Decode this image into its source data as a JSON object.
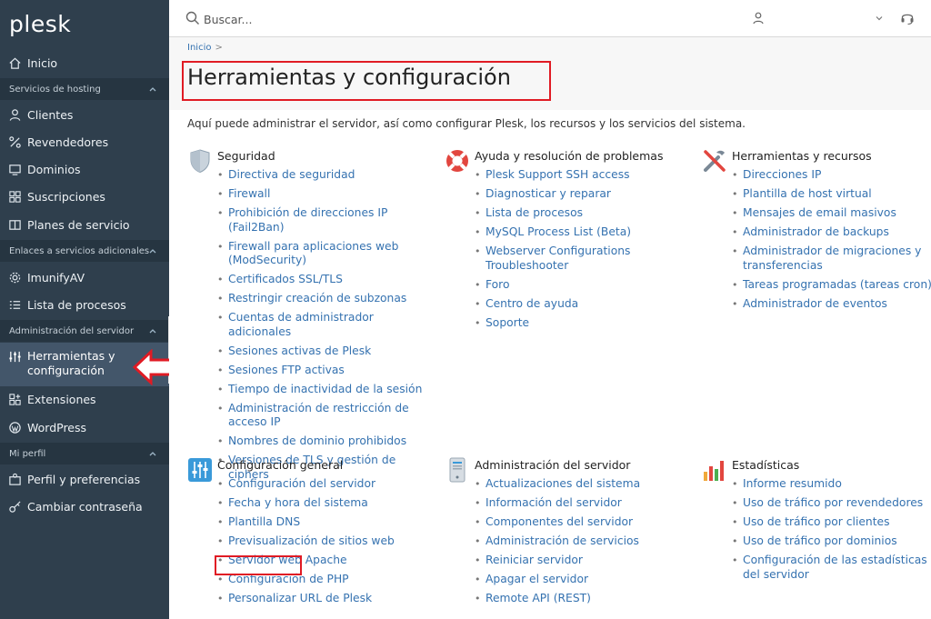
{
  "app": {
    "logo": "plesk"
  },
  "search": {
    "placeholder": "Buscar..."
  },
  "sidebar": {
    "home": "Inicio",
    "sections": [
      {
        "label": "Servicios de hosting"
      },
      {
        "label": "Enlaces a servicios adicionales"
      },
      {
        "label": "Administración del servidor"
      },
      {
        "label": "Mi perfil"
      }
    ],
    "items": [
      {
        "label": "Clientes"
      },
      {
        "label": "Revendedores"
      },
      {
        "label": "Dominios"
      },
      {
        "label": "Suscripciones"
      },
      {
        "label": "Planes de servicio"
      },
      {
        "label": "ImunifyAV"
      },
      {
        "label": "Lista de procesos"
      },
      {
        "label": "Herramientas y configuración"
      },
      {
        "label": "Extensiones"
      },
      {
        "label": "WordPress"
      },
      {
        "label": "Perfil y preferencias"
      },
      {
        "label": "Cambiar contraseña"
      }
    ]
  },
  "breadcrumb": {
    "home": "Inicio",
    "sep": ">"
  },
  "page": {
    "title": "Herramientas y configuración",
    "intro": "Aquí puede administrar el servidor, así como configurar Plesk, los recursos y los servicios del sistema."
  },
  "groups": [
    {
      "title": "Seguridad",
      "icon": "shield-icon",
      "links": [
        "Directiva de seguridad",
        "Firewall",
        "Prohibición de direcciones IP (Fail2Ban)",
        "Firewall para aplicaciones web (ModSecurity)",
        "Certificados SSL/TLS",
        "Restringir creación de subzonas",
        "Cuentas de administrador adicionales",
        "Sesiones activas de Plesk",
        "Sesiones FTP activas",
        "Tiempo de inactividad de la sesión",
        "Administración de restricción de acceso IP",
        "Nombres de dominio prohibidos",
        "Versiones de TLS y gestión de ciphers"
      ]
    },
    {
      "title": "Ayuda y resolución de problemas",
      "icon": "lifebuoy-icon",
      "links": [
        "Plesk Support SSH access",
        "Diagnosticar y reparar",
        "Lista de procesos",
        "MySQL Process List (Beta)",
        "Webserver Configurations Troubleshooter",
        "Foro",
        "Centro de ayuda",
        "Soporte"
      ]
    },
    {
      "title": "Herramientas y recursos",
      "icon": "tools-icon",
      "links": [
        "Direcciones IP",
        "Plantilla de host virtual",
        "Mensajes de email masivos",
        "Administrador de backups",
        "Administrador de migraciones y transferencias",
        "Tareas programadas (tareas cron)",
        "Administrador de eventos"
      ]
    },
    {
      "title": "Configuración general",
      "icon": "sliders-icon",
      "links": [
        "Configuración del servidor",
        "Fecha y hora del sistema",
        "Plantilla DNS",
        "Previsualización de sitios web",
        "Servidor web Apache",
        "Configuración de PHP",
        "Personalizar URL de Plesk"
      ]
    },
    {
      "title": "Administración del servidor",
      "icon": "server-icon",
      "links": [
        "Actualizaciones del sistema",
        "Información del servidor",
        "Componentes del servidor",
        "Administración de servicios",
        "Reiniciar servidor",
        "Apagar el servidor",
        "Remote API (REST)"
      ]
    },
    {
      "title": "Estadísticas",
      "icon": "bar-chart-icon",
      "links": [
        "Informe resumido",
        "Uso de tráfico por revendedores",
        "Uso de tráfico por clientes",
        "Uso de tráfico por dominios",
        "Configuración de las estadísticas del servidor"
      ]
    }
  ],
  "colors": {
    "sidebar": "#2f3f4d",
    "section": "#263541",
    "active": "#43566a",
    "link": "#3572b0",
    "highlight": "#e01b24"
  }
}
